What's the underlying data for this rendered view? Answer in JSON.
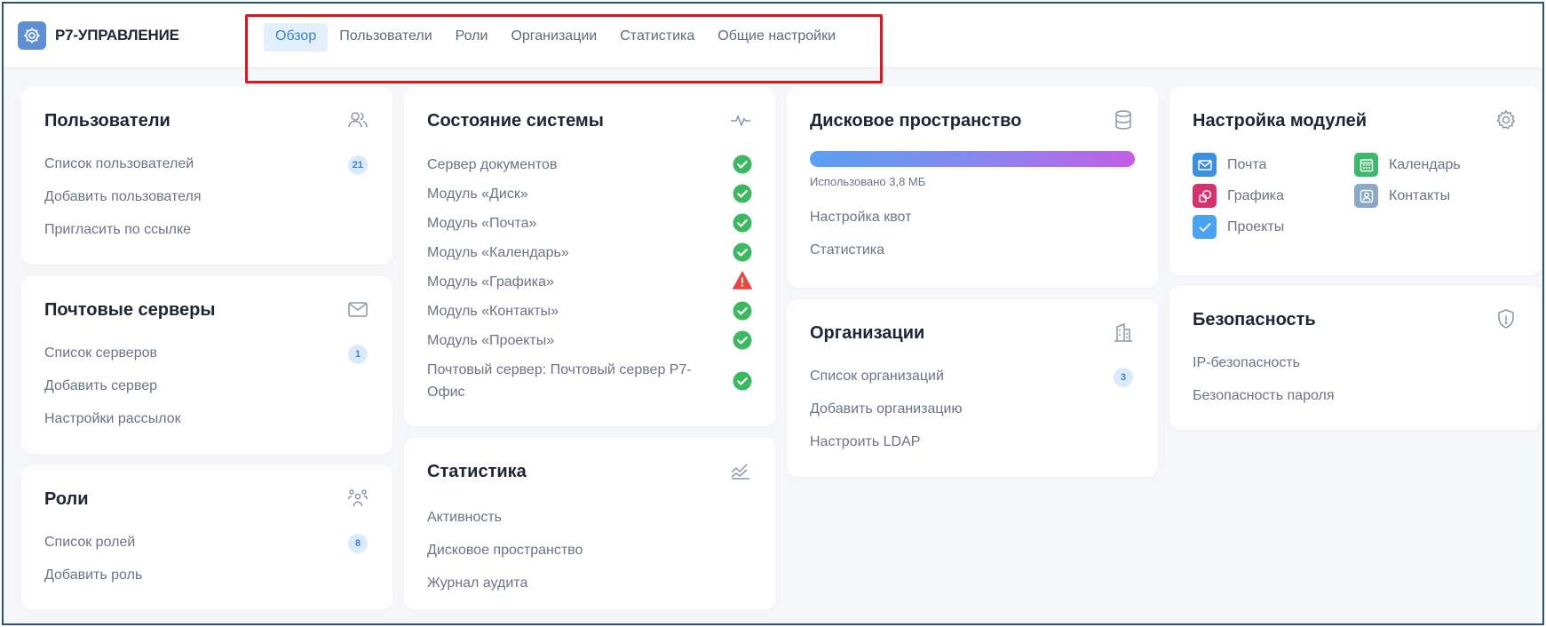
{
  "app": {
    "title": "Р7-УПРАВЛЕНИЕ",
    "logo_icon": "gear-icon"
  },
  "nav": {
    "tabs": [
      {
        "label": "Обзор",
        "active": true
      },
      {
        "label": "Пользователи",
        "active": false
      },
      {
        "label": "Роли",
        "active": false
      },
      {
        "label": "Организации",
        "active": false
      },
      {
        "label": "Статистика",
        "active": false
      },
      {
        "label": "Общие настройки",
        "active": false
      }
    ]
  },
  "users_card": {
    "title": "Пользователи",
    "icon": "users-icon",
    "links": [
      "Список пользователей",
      "Добавить пользователя",
      "Пригласить по ссылке"
    ],
    "badge": "21"
  },
  "mail_card": {
    "title": "Почтовые серверы",
    "icon": "mail-icon",
    "links": [
      "Список серверов",
      "Добавить сервер",
      "Настройки рассылок"
    ],
    "badge": "1"
  },
  "roles_card": {
    "title": "Роли",
    "icon": "roles-icon",
    "links": [
      "Список ролей",
      "Добавить роль"
    ],
    "badge": "8"
  },
  "system_card": {
    "title": "Состояние системы",
    "icon": "pulse-icon",
    "items": [
      {
        "label": "Сервер документов",
        "status": "ok"
      },
      {
        "label": "Модуль «Диск»",
        "status": "ok"
      },
      {
        "label": "Модуль «Почта»",
        "status": "ok"
      },
      {
        "label": "Модуль «Календарь»",
        "status": "ok"
      },
      {
        "label": "Модуль «Графика»",
        "status": "warning"
      },
      {
        "label": "Модуль «Контакты»",
        "status": "ok"
      },
      {
        "label": "Модуль «Проекты»",
        "status": "ok"
      },
      {
        "label": "Почтовый сервер: Почтовый сервер Р7-Офис",
        "status": "ok"
      }
    ]
  },
  "stats_card": {
    "title": "Статистика",
    "icon": "chart-icon",
    "links": [
      "Активность",
      "Дисковое пространство",
      "Журнал аудита"
    ]
  },
  "disk_card": {
    "title": "Дисковое пространство",
    "icon": "database-icon",
    "used_text": "Использовано 3,8 МБ",
    "links": [
      "Настройка квот",
      "Статистика"
    ]
  },
  "org_card": {
    "title": "Организации",
    "icon": "building-icon",
    "links": [
      "Список организаций",
      "Добавить организацию",
      "Настроить LDAP"
    ],
    "badge": "3"
  },
  "modules_card": {
    "title": "Настройка модулей",
    "icon": "gear-icon",
    "modules": [
      {
        "label": "Почта",
        "icon": "mail-module-icon",
        "color": "#3b8fe0"
      },
      {
        "label": "Календарь",
        "icon": "calendar-module-icon",
        "color": "#3cb96a"
      },
      {
        "label": "Графика",
        "icon": "graphics-module-icon",
        "color": "#d8326e"
      },
      {
        "label": "Контакты",
        "icon": "contacts-module-icon",
        "color": "#8aa8c8"
      },
      {
        "label": "Проекты",
        "icon": "projects-module-icon",
        "color": "#4aa3ee"
      }
    ]
  },
  "security_card": {
    "title": "Безопасность",
    "icon": "shield-icon",
    "links": [
      "IP-безопасность",
      "Безопасность пароля"
    ]
  },
  "colors": {
    "accent": "#3b82c9",
    "ok": "#3cb862",
    "warning": "#e5483f",
    "highlight": "#e0141b"
  }
}
